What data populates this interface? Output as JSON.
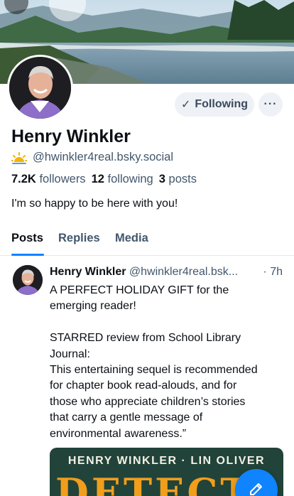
{
  "profile": {
    "display_name": "Henry Winkler",
    "handle": "@hwinkler4real.bsky.social",
    "followers_count": "7.2K",
    "followers_label": "followers",
    "following_count": "12",
    "following_label": "following",
    "posts_count": "3",
    "posts_label": "posts",
    "bio": "I'm so happy to be here with you!"
  },
  "actions": {
    "following_label": "Following",
    "more_label": "···"
  },
  "tabs": [
    {
      "label": "Posts",
      "active": true
    },
    {
      "label": "Replies",
      "active": false
    },
    {
      "label": "Media",
      "active": false
    }
  ],
  "post": {
    "author": "Henry Winkler",
    "handle": "@hwinkler4real.bsk...",
    "time": "· 7h",
    "text": "A PERFECT HOLIDAY GIFT for the\nemerging reader!\n\nSTARRED review from School Library\nJournal:\nThis entertaining sequel is recommended\nfor chapter book read-alouds, and for\nthose who appreciate children’s stories\nthat carry a gentle message of\nenvironmental awareness.”",
    "image_authors": "HENRY WINKLER · LIN OLIVER",
    "image_title": "DETECTI"
  },
  "icons": {
    "handle_emoji": "sun-icon",
    "compose": "compose-icon",
    "check": "check-icon"
  },
  "colors": {
    "accent": "#1083fe",
    "muted_text": "#42576c",
    "button_bg": "#eef1f5"
  }
}
